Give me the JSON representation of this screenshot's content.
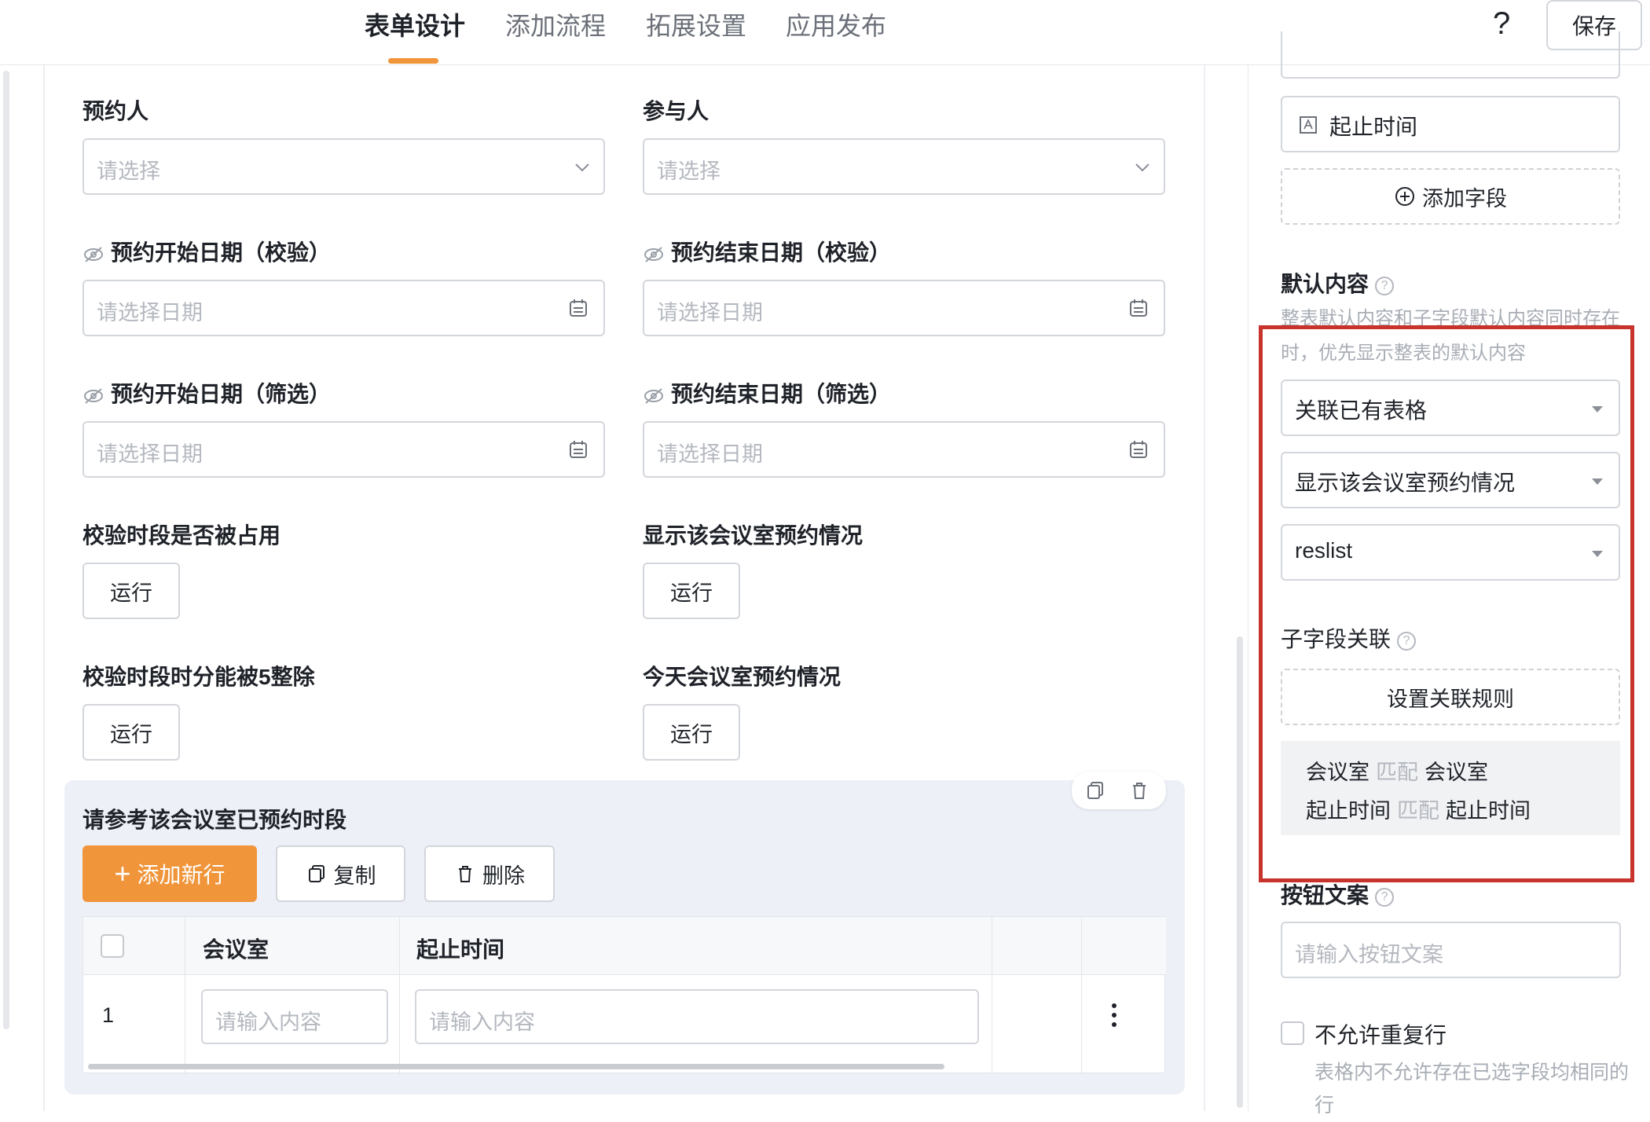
{
  "header": {
    "tabs": [
      {
        "label": "表单设计",
        "active": true
      },
      {
        "label": "添加流程",
        "active": false
      },
      {
        "label": "拓展设置",
        "active": false
      },
      {
        "label": "应用发布",
        "active": false
      }
    ],
    "help": "?",
    "save_label": "保存"
  },
  "form": {
    "booker": {
      "label": "预约人",
      "placeholder": "请选择"
    },
    "participants": {
      "label": "参与人",
      "placeholder": "请选择"
    },
    "start_check": {
      "label": "预约开始日期（校验）",
      "placeholder": "请选择日期"
    },
    "end_check": {
      "label": "预约结束日期（校验）",
      "placeholder": "请选择日期"
    },
    "start_filter": {
      "label": "预约开始日期（筛选）",
      "placeholder": "请选择日期"
    },
    "end_filter": {
      "label": "预约结束日期（筛选）",
      "placeholder": "请选择日期"
    },
    "check_occupied": {
      "label": "校验时段是否被占用",
      "button": "运行"
    },
    "show_room_booking": {
      "label": "显示该会议室预约情况",
      "button": "运行"
    },
    "check_divisible": {
      "label": "校验时段时分能被5整除",
      "button": "运行"
    },
    "today_booking": {
      "label": "今天会议室预约情况",
      "button": "运行"
    }
  },
  "subtable": {
    "title": "请参考该会议室已预约时段",
    "add_row": "添加新行",
    "copy": "复制",
    "delete": "删除",
    "columns": [
      "会议室",
      "起止时间"
    ],
    "rows": [
      {
        "index": "1",
        "room_placeholder": "请输入内容",
        "time_placeholder": "请输入内容"
      }
    ]
  },
  "right_panel": {
    "field_top": "起止时间",
    "add_field": "添加字段",
    "default_content_title": "默认内容",
    "default_content_help": "整表默认内容和子字段默认内容同时存在时，优先显示整表的默认内容",
    "select_1": "关联已有表格",
    "select_2": "显示该会议室预约情况",
    "select_3": "reslist",
    "subfield_title": "子字段关联",
    "set_rule": "设置关联规则",
    "mappings": [
      {
        "left": "会议室",
        "op": "匹配",
        "right": "会议室"
      },
      {
        "left": "起止时间",
        "op": "匹配",
        "right": "起止时间"
      }
    ],
    "button_text_title": "按钮文案",
    "button_text_placeholder": "请输入按钮文案",
    "no_duplicate_label": "不允许重复行",
    "no_duplicate_help": "表格内不允许存在已选字段均相同的行"
  },
  "colors": {
    "accent": "#f0953a",
    "highlight_frame": "#c8332b"
  }
}
